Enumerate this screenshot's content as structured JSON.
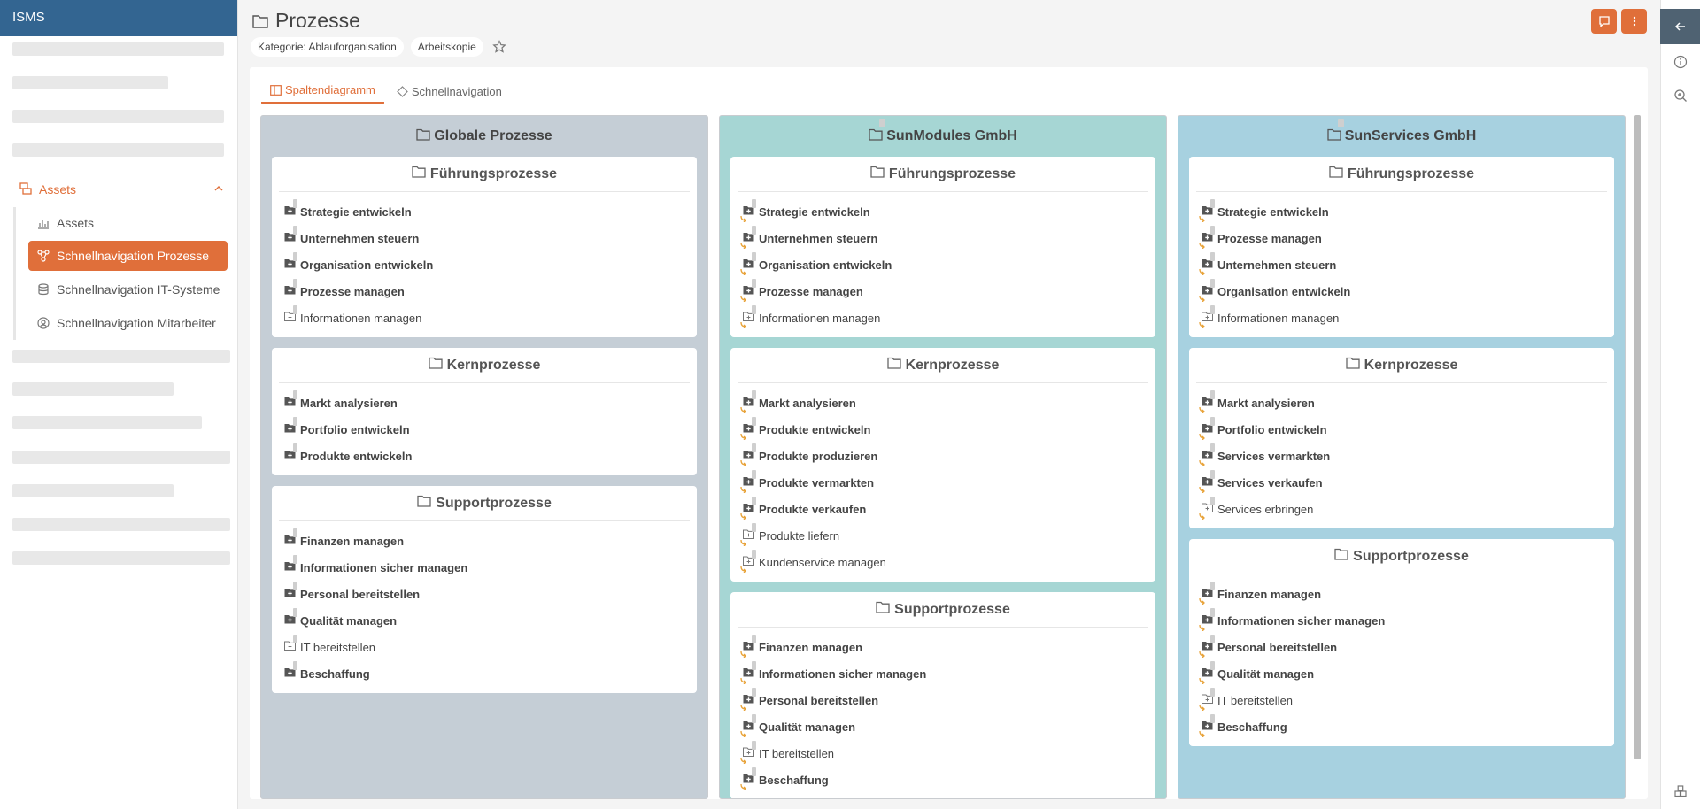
{
  "sidebar": {
    "app_title": "ISMS",
    "group_label": "Assets",
    "items": [
      {
        "label": "Assets"
      },
      {
        "label": "Schnellnavigation Prozesse"
      },
      {
        "label": "Schnellnavigation IT-Systeme"
      },
      {
        "label": "Schnellnavigation Mitarbeiter"
      }
    ]
  },
  "header": {
    "title": "Prozesse",
    "chips": [
      "Kategorie: Ablauforganisation",
      "Arbeitskopie"
    ]
  },
  "tabs": [
    "Spaltendiagramm",
    "Schnellnavigation"
  ],
  "columns": [
    {
      "title": "Globale Prozesse",
      "bg": "#c5ced6",
      "sections": [
        {
          "title": "Führungsprozesse",
          "items": [
            {
              "label": "Strategie entwickeln",
              "bold": true
            },
            {
              "label": "Unternehmen steuern",
              "bold": true
            },
            {
              "label": "Organisation entwickeln",
              "bold": true
            },
            {
              "label": "Prozesse managen",
              "bold": true
            },
            {
              "label": "Informationen managen",
              "bold": false
            }
          ]
        },
        {
          "title": "Kernprozesse",
          "items": [
            {
              "label": "Markt analysieren",
              "bold": true
            },
            {
              "label": "Portfolio entwickeln",
              "bold": true
            },
            {
              "label": "Produkte entwickeln",
              "bold": true
            }
          ]
        },
        {
          "title": "Supportprozesse",
          "items": [
            {
              "label": "Finanzen managen",
              "bold": true
            },
            {
              "label": "Informationen sicher managen",
              "bold": true
            },
            {
              "label": "Personal bereitstellen",
              "bold": true
            },
            {
              "label": "Qualität managen",
              "bold": true
            },
            {
              "label": "IT bereitstellen",
              "bold": false
            },
            {
              "label": "Beschaffung",
              "bold": true
            }
          ]
        }
      ]
    },
    {
      "title": "SunModules GmbH",
      "bg": "#a6d6d4",
      "sections": [
        {
          "title": "Führungsprozesse",
          "items": [
            {
              "label": "Strategie entwickeln",
              "bold": true
            },
            {
              "label": "Unternehmen steuern",
              "bold": true
            },
            {
              "label": "Organisation entwickeln",
              "bold": true
            },
            {
              "label": "Prozesse managen",
              "bold": true
            },
            {
              "label": "Informationen managen",
              "bold": false
            }
          ]
        },
        {
          "title": "Kernprozesse",
          "items": [
            {
              "label": "Markt analysieren",
              "bold": true
            },
            {
              "label": "Produkte entwickeln",
              "bold": true
            },
            {
              "label": "Produkte produzieren",
              "bold": true
            },
            {
              "label": "Produkte vermarkten",
              "bold": true
            },
            {
              "label": "Produkte verkaufen",
              "bold": true
            },
            {
              "label": "Produkte liefern",
              "bold": false
            },
            {
              "label": "Kundenservice managen",
              "bold": false
            }
          ]
        },
        {
          "title": "Supportprozesse",
          "items": [
            {
              "label": "Finanzen managen",
              "bold": true
            },
            {
              "label": "Informationen sicher managen",
              "bold": true
            },
            {
              "label": "Personal bereitstellen",
              "bold": true
            },
            {
              "label": "Qualität managen",
              "bold": true
            },
            {
              "label": "IT bereitstellen",
              "bold": false
            },
            {
              "label": "Beschaffung",
              "bold": true
            }
          ]
        }
      ]
    },
    {
      "title": "SunServices GmbH",
      "bg": "#a7d1e0",
      "sections": [
        {
          "title": "Führungsprozesse",
          "items": [
            {
              "label": "Strategie entwickeln",
              "bold": true
            },
            {
              "label": "Prozesse managen",
              "bold": true
            },
            {
              "label": "Unternehmen steuern",
              "bold": true
            },
            {
              "label": "Organisation entwickeln",
              "bold": true
            },
            {
              "label": "Informationen managen",
              "bold": false
            }
          ]
        },
        {
          "title": "Kernprozesse",
          "items": [
            {
              "label": "Markt analysieren",
              "bold": true
            },
            {
              "label": "Portfolio entwickeln",
              "bold": true
            },
            {
              "label": "Services vermarkten",
              "bold": true
            },
            {
              "label": "Services verkaufen",
              "bold": true
            },
            {
              "label": "Services erbringen",
              "bold": false
            }
          ]
        },
        {
          "title": "Supportprozesse",
          "items": [
            {
              "label": "Finanzen managen",
              "bold": true
            },
            {
              "label": "Informationen sicher managen",
              "bold": true
            },
            {
              "label": "Personal bereitstellen",
              "bold": true
            },
            {
              "label": "Qualität managen",
              "bold": true
            },
            {
              "label": "IT bereitstellen",
              "bold": false
            },
            {
              "label": "Beschaffung",
              "bold": true
            }
          ]
        }
      ]
    }
  ],
  "colors": {
    "accent": "#e06f3a",
    "header_blue": "#336591",
    "rail_dark": "#4f6272"
  }
}
